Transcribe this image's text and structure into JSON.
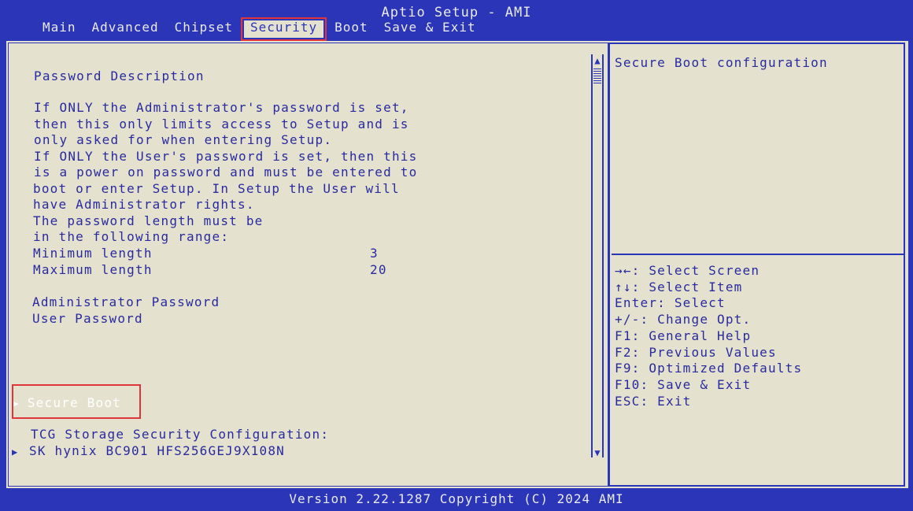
{
  "title": "Aptio Setup - AMI",
  "tabs": [
    "Main",
    "Advanced",
    "Chipset",
    "Security",
    "Boot",
    "Save & Exit"
  ],
  "active_tab": "Security",
  "main": {
    "section_title": "Password Description",
    "description_lines": [
      "If ONLY the Administrator's password is set,",
      "then this only limits access to Setup and is",
      "only asked for when entering Setup.",
      "If ONLY the User's password is set, then this",
      "is a power on password and must be entered to",
      "boot or enter Setup. In Setup the User will",
      "have Administrator rights.",
      "The password length must be",
      "in the following range:"
    ],
    "min_length_label": "Minimum length",
    "min_length_value": "3",
    "max_length_label": "Maximum length",
    "max_length_value": "20",
    "admin_password_label": "Administrator Password",
    "user_password_label": "User Password",
    "secure_boot_label": "Secure Boot",
    "tcg_label": "TCG Storage Security Configuration:",
    "tcg_device": "SK hynix BC901 HFS256GEJ9X108N"
  },
  "help": {
    "title": "Secure Boot configuration",
    "keys": [
      "→←: Select Screen",
      "↑↓: Select Item",
      "Enter: Select",
      "+/-: Change Opt.",
      "F1: General Help",
      "F2: Previous Values",
      "F9: Optimized Defaults",
      "F10: Save & Exit",
      "ESC: Exit"
    ]
  },
  "footer": "Version 2.22.1287 Copyright (C) 2024 AMI",
  "colors": {
    "background_blue": "#2a35b8",
    "panel_beige": "#e4e2cf",
    "highlight_red": "#e0353a"
  }
}
